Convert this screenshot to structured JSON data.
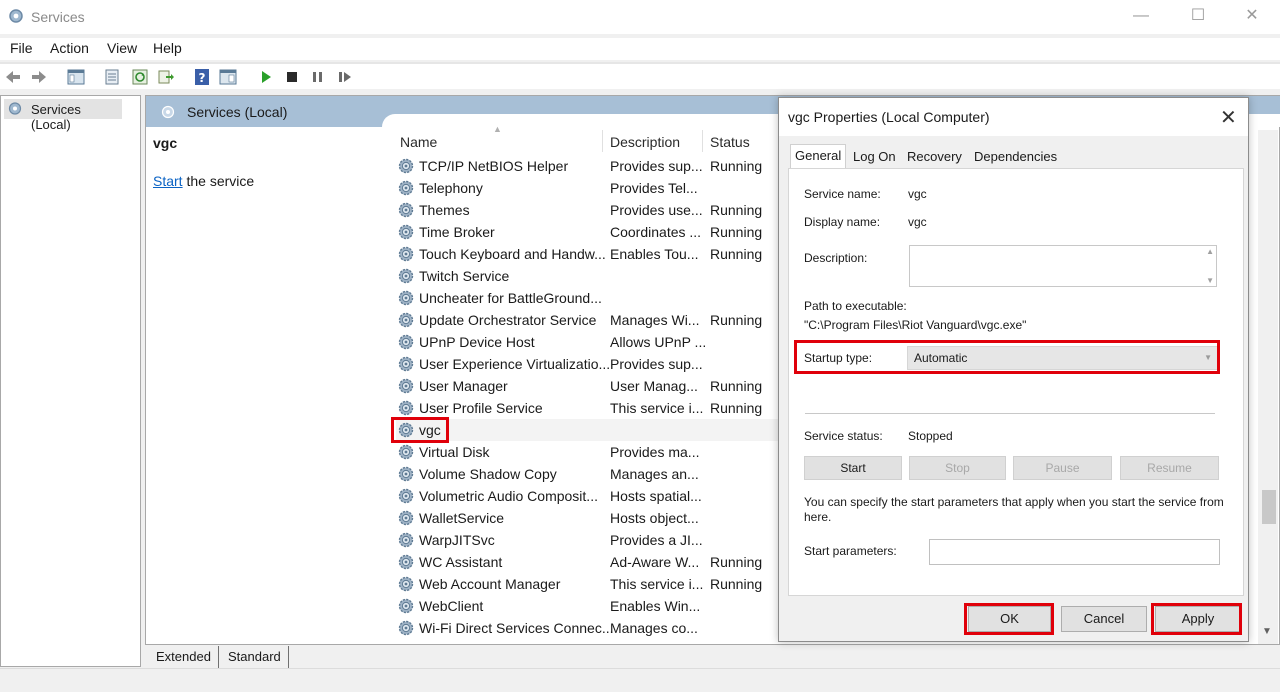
{
  "window": {
    "title": "Services"
  },
  "menu": [
    "File",
    "Action",
    "View",
    "Help"
  ],
  "tree": {
    "root": "Services (Local)"
  },
  "main": {
    "header": "Services (Local)",
    "selected_name": "vgc",
    "action_link": "Start",
    "action_rest": " the service",
    "columns": {
      "name": "Name",
      "description": "Description",
      "status": "Status"
    },
    "rows": [
      {
        "name": "TCP/IP NetBIOS Helper",
        "desc": "Provides sup...",
        "status": "Running"
      },
      {
        "name": "Telephony",
        "desc": "Provides Tel...",
        "status": ""
      },
      {
        "name": "Themes",
        "desc": "Provides use...",
        "status": "Running"
      },
      {
        "name": "Time Broker",
        "desc": "Coordinates ...",
        "status": "Running"
      },
      {
        "name": "Touch Keyboard and Handw...",
        "desc": "Enables Tou...",
        "status": "Running"
      },
      {
        "name": "Twitch Service",
        "desc": "",
        "status": ""
      },
      {
        "name": "Uncheater for BattleGround...",
        "desc": "",
        "status": ""
      },
      {
        "name": "Update Orchestrator Service",
        "desc": "Manages Wi...",
        "status": "Running"
      },
      {
        "name": "UPnP Device Host",
        "desc": "Allows UPnP ...",
        "status": ""
      },
      {
        "name": "User Experience Virtualizatio...",
        "desc": "Provides sup...",
        "status": ""
      },
      {
        "name": "User Manager",
        "desc": "User Manag...",
        "status": "Running"
      },
      {
        "name": "User Profile Service",
        "desc": "This service i...",
        "status": "Running"
      },
      {
        "name": "vgc",
        "desc": "",
        "status": ""
      },
      {
        "name": "Virtual Disk",
        "desc": "Provides ma...",
        "status": ""
      },
      {
        "name": "Volume Shadow Copy",
        "desc": "Manages an...",
        "status": ""
      },
      {
        "name": "Volumetric Audio Composit...",
        "desc": "Hosts spatial...",
        "status": ""
      },
      {
        "name": "WalletService",
        "desc": "Hosts object...",
        "status": ""
      },
      {
        "name": "WarpJITSvc",
        "desc": "Provides a JI...",
        "status": ""
      },
      {
        "name": "WC Assistant",
        "desc": "Ad-Aware W...",
        "status": "Running"
      },
      {
        "name": "Web Account Manager",
        "desc": "This service i...",
        "status": "Running"
      },
      {
        "name": "WebClient",
        "desc": "Enables Win...",
        "status": ""
      },
      {
        "name": "Wi-Fi Direct Services Connec...",
        "desc": "Manages co...",
        "status": ""
      }
    ],
    "bottom_tabs": [
      "Extended",
      "Standard"
    ]
  },
  "dialog": {
    "title": "vgc Properties (Local Computer)",
    "tabs": [
      "General",
      "Log On",
      "Recovery",
      "Dependencies"
    ],
    "service_name_label": "Service name:",
    "service_name": "vgc",
    "display_name_label": "Display name:",
    "display_name": "vgc",
    "description_label": "Description:",
    "path_label": "Path to executable:",
    "path": "\"C:\\Program Files\\Riot Vanguard\\vgc.exe\"",
    "startup_label": "Startup type:",
    "startup_value": "Automatic",
    "status_label": "Service status:",
    "status_value": "Stopped",
    "buttons": {
      "start": "Start",
      "stop": "Stop",
      "pause": "Pause",
      "resume": "Resume"
    },
    "info": "You can specify the start parameters that apply when you start the service from here.",
    "params_label": "Start parameters:",
    "ok": "OK",
    "cancel": "Cancel",
    "apply": "Apply"
  },
  "colors": {
    "highlight": "#e0000a",
    "header": "#a7bfd6",
    "link": "#0b63c4"
  }
}
